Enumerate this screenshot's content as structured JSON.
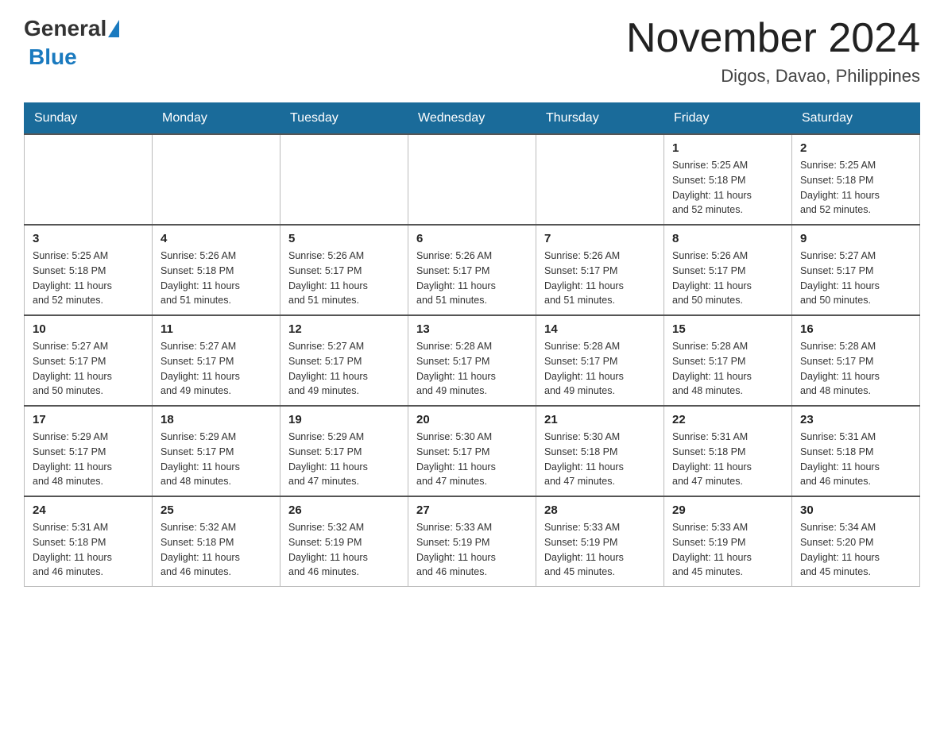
{
  "header": {
    "logo_general": "General",
    "logo_blue": "Blue",
    "month_title": "November 2024",
    "location": "Digos, Davao, Philippines"
  },
  "days_of_week": [
    "Sunday",
    "Monday",
    "Tuesday",
    "Wednesday",
    "Thursday",
    "Friday",
    "Saturday"
  ],
  "weeks": [
    [
      {
        "day": "",
        "info": ""
      },
      {
        "day": "",
        "info": ""
      },
      {
        "day": "",
        "info": ""
      },
      {
        "day": "",
        "info": ""
      },
      {
        "day": "",
        "info": ""
      },
      {
        "day": "1",
        "info": "Sunrise: 5:25 AM\nSunset: 5:18 PM\nDaylight: 11 hours\nand 52 minutes."
      },
      {
        "day": "2",
        "info": "Sunrise: 5:25 AM\nSunset: 5:18 PM\nDaylight: 11 hours\nand 52 minutes."
      }
    ],
    [
      {
        "day": "3",
        "info": "Sunrise: 5:25 AM\nSunset: 5:18 PM\nDaylight: 11 hours\nand 52 minutes."
      },
      {
        "day": "4",
        "info": "Sunrise: 5:26 AM\nSunset: 5:18 PM\nDaylight: 11 hours\nand 51 minutes."
      },
      {
        "day": "5",
        "info": "Sunrise: 5:26 AM\nSunset: 5:17 PM\nDaylight: 11 hours\nand 51 minutes."
      },
      {
        "day": "6",
        "info": "Sunrise: 5:26 AM\nSunset: 5:17 PM\nDaylight: 11 hours\nand 51 minutes."
      },
      {
        "day": "7",
        "info": "Sunrise: 5:26 AM\nSunset: 5:17 PM\nDaylight: 11 hours\nand 51 minutes."
      },
      {
        "day": "8",
        "info": "Sunrise: 5:26 AM\nSunset: 5:17 PM\nDaylight: 11 hours\nand 50 minutes."
      },
      {
        "day": "9",
        "info": "Sunrise: 5:27 AM\nSunset: 5:17 PM\nDaylight: 11 hours\nand 50 minutes."
      }
    ],
    [
      {
        "day": "10",
        "info": "Sunrise: 5:27 AM\nSunset: 5:17 PM\nDaylight: 11 hours\nand 50 minutes."
      },
      {
        "day": "11",
        "info": "Sunrise: 5:27 AM\nSunset: 5:17 PM\nDaylight: 11 hours\nand 49 minutes."
      },
      {
        "day": "12",
        "info": "Sunrise: 5:27 AM\nSunset: 5:17 PM\nDaylight: 11 hours\nand 49 minutes."
      },
      {
        "day": "13",
        "info": "Sunrise: 5:28 AM\nSunset: 5:17 PM\nDaylight: 11 hours\nand 49 minutes."
      },
      {
        "day": "14",
        "info": "Sunrise: 5:28 AM\nSunset: 5:17 PM\nDaylight: 11 hours\nand 49 minutes."
      },
      {
        "day": "15",
        "info": "Sunrise: 5:28 AM\nSunset: 5:17 PM\nDaylight: 11 hours\nand 48 minutes."
      },
      {
        "day": "16",
        "info": "Sunrise: 5:28 AM\nSunset: 5:17 PM\nDaylight: 11 hours\nand 48 minutes."
      }
    ],
    [
      {
        "day": "17",
        "info": "Sunrise: 5:29 AM\nSunset: 5:17 PM\nDaylight: 11 hours\nand 48 minutes."
      },
      {
        "day": "18",
        "info": "Sunrise: 5:29 AM\nSunset: 5:17 PM\nDaylight: 11 hours\nand 48 minutes."
      },
      {
        "day": "19",
        "info": "Sunrise: 5:29 AM\nSunset: 5:17 PM\nDaylight: 11 hours\nand 47 minutes."
      },
      {
        "day": "20",
        "info": "Sunrise: 5:30 AM\nSunset: 5:17 PM\nDaylight: 11 hours\nand 47 minutes."
      },
      {
        "day": "21",
        "info": "Sunrise: 5:30 AM\nSunset: 5:18 PM\nDaylight: 11 hours\nand 47 minutes."
      },
      {
        "day": "22",
        "info": "Sunrise: 5:31 AM\nSunset: 5:18 PM\nDaylight: 11 hours\nand 47 minutes."
      },
      {
        "day": "23",
        "info": "Sunrise: 5:31 AM\nSunset: 5:18 PM\nDaylight: 11 hours\nand 46 minutes."
      }
    ],
    [
      {
        "day": "24",
        "info": "Sunrise: 5:31 AM\nSunset: 5:18 PM\nDaylight: 11 hours\nand 46 minutes."
      },
      {
        "day": "25",
        "info": "Sunrise: 5:32 AM\nSunset: 5:18 PM\nDaylight: 11 hours\nand 46 minutes."
      },
      {
        "day": "26",
        "info": "Sunrise: 5:32 AM\nSunset: 5:19 PM\nDaylight: 11 hours\nand 46 minutes."
      },
      {
        "day": "27",
        "info": "Sunrise: 5:33 AM\nSunset: 5:19 PM\nDaylight: 11 hours\nand 46 minutes."
      },
      {
        "day": "28",
        "info": "Sunrise: 5:33 AM\nSunset: 5:19 PM\nDaylight: 11 hours\nand 45 minutes."
      },
      {
        "day": "29",
        "info": "Sunrise: 5:33 AM\nSunset: 5:19 PM\nDaylight: 11 hours\nand 45 minutes."
      },
      {
        "day": "30",
        "info": "Sunrise: 5:34 AM\nSunset: 5:20 PM\nDaylight: 11 hours\nand 45 minutes."
      }
    ]
  ]
}
